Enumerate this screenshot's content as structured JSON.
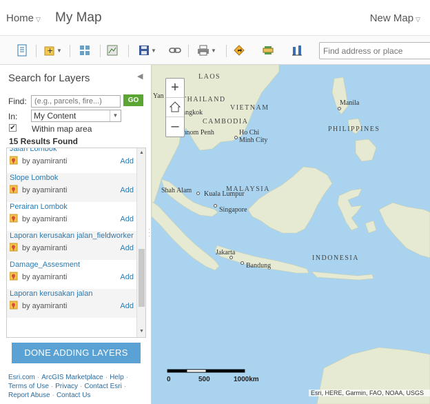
{
  "header": {
    "home_label": "Home",
    "title": "My Map",
    "new_map_label": "New Map"
  },
  "toolbar": {
    "search_placeholder": "Find address or place"
  },
  "panel": {
    "title": "Search for Layers",
    "find_label": "Find:",
    "find_placeholder": "(e.g., parcels, fire...)",
    "go_label": "GO",
    "in_label": "In:",
    "in_value": "My Content",
    "within_label": "Within map area",
    "within_checked": true,
    "results_label": "15 Results Found",
    "items": [
      {
        "title": "Jalan Lombok",
        "owner": "by ayamiranti",
        "add": "Add"
      },
      {
        "title": "Slope Lombok",
        "owner": "by ayamiranti",
        "add": "Add"
      },
      {
        "title": "Perairan Lombok",
        "owner": "by ayamiranti",
        "add": "Add"
      },
      {
        "title": "Laporan kerusakan jalan_fieldworker",
        "owner": "by ayamiranti",
        "add": "Add"
      },
      {
        "title": "Damage_Assesment",
        "owner": "by ayamiranti",
        "add": "Add"
      },
      {
        "title": "Laporan kerusakan jalan",
        "owner": "by ayamiranti",
        "add": "Add"
      }
    ],
    "done_label": "DONE ADDING LAYERS"
  },
  "footer": {
    "links": [
      "Esri.com",
      "ArcGIS Marketplace",
      "Help",
      "Terms of Use",
      "Privacy",
      "Contact Esri",
      "Report Abuse",
      "Contact Us"
    ]
  },
  "map": {
    "labels": {
      "laos": "LAOS",
      "thailand": "THAILAND",
      "vietnam": "VIETNAM",
      "cambodia": "CAMBODIA",
      "philippines": "PHILIPPINES",
      "malaysia": "MALAYSIA",
      "indonesia": "INDONESIA",
      "yangon": "Yan",
      "bangkok": "Bangkok",
      "phnom_penh": "Phnom Penh",
      "ho_chi_minh": "Ho Chi Minh City",
      "manila": "Manila",
      "shah_alam": "Shah Alam",
      "kuala_lumpur": "Kuala Lumpur",
      "singapore": "Singapore",
      "jakarta": "Jakarta",
      "bandung": "Bandung"
    },
    "scale": {
      "ticks": [
        "0",
        "500",
        "1000km"
      ]
    },
    "attribution": "Esri, HERE, Garmin, FAO, NOAA, USGS"
  },
  "colors": {
    "accent_green": "#5ba633",
    "button_blue": "#5ba2d4",
    "link_blue": "#2a7ab0",
    "water": "#a9d3ee",
    "land": "#e8ecd6"
  }
}
